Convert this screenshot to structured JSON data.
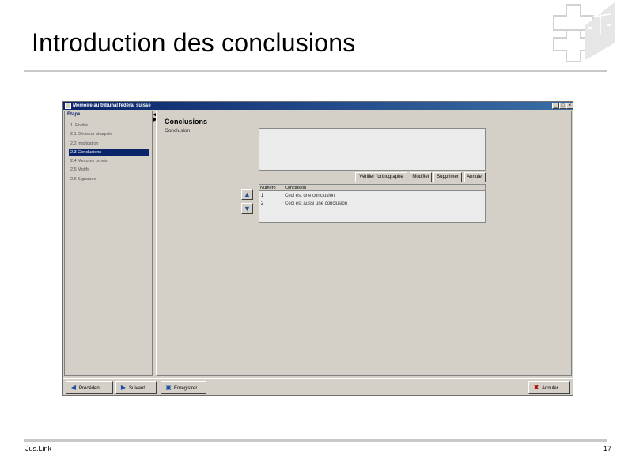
{
  "slide": {
    "title": "Introduction des conclusions",
    "footer_left": "Jus.Link",
    "page_number": "17"
  },
  "window": {
    "title": "Mémoire au tribunal fédéral suisse",
    "controls": {
      "minimize": "_",
      "maximize": "□",
      "close": "×"
    }
  },
  "steps": {
    "header": "Etape",
    "items": [
      {
        "label": "1. Entête",
        "selected": false
      },
      {
        "label": "2.1 Décision attaquée",
        "selected": false
      },
      {
        "label": "2.2 Implication",
        "selected": false
      },
      {
        "label": "2.3 Conclusions",
        "selected": true
      },
      {
        "label": "2.4 Mesures provis.",
        "selected": false
      },
      {
        "label": "2.5 Motifs",
        "selected": false
      },
      {
        "label": "2.6 Signature",
        "selected": false
      }
    ]
  },
  "conclusions": {
    "title": "Conclusions",
    "field_label": "Conclusion",
    "buttons": {
      "check_spelling": "Vérifier l'orthographe",
      "add": "Modifier",
      "delete": "Supprimer",
      "cancel": "Annuler"
    },
    "table": {
      "columns": [
        "Numéro",
        "Conclusion"
      ],
      "rows": [
        {
          "num": "1",
          "text": "Ceci est une conclusion"
        },
        {
          "num": "2",
          "text": "Ceci est aussi une conclusion"
        }
      ]
    }
  },
  "footer_buttons": {
    "previous": "Précédent",
    "next": "Suivant",
    "save": "Enregistrer",
    "cancel": "Annuler"
  }
}
